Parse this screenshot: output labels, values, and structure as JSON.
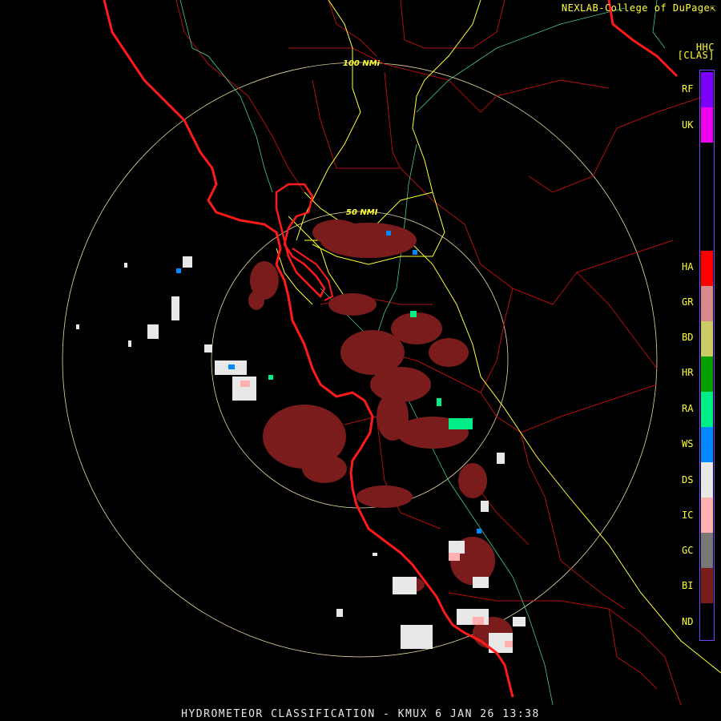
{
  "header": {
    "credit": "NEXLAB-College of DuPage",
    "credit_icon": "external-link-icon",
    "product_code": "HHC",
    "product_mode": "[CLAS]"
  },
  "rings": [
    {
      "label": "50 NMI"
    },
    {
      "label": "100 NMI"
    }
  ],
  "legend": [
    {
      "code": "RF",
      "color": "#7b00ff"
    },
    {
      "code": "UK",
      "color": "#ee00ee"
    },
    {
      "code": "HA",
      "color": "#ff0000"
    },
    {
      "code": "GR",
      "color": "#d88a8a"
    },
    {
      "code": "BD",
      "color": "#cccc66"
    },
    {
      "code": "HR",
      "color": "#00a000"
    },
    {
      "code": "RA",
      "color": "#00ee88"
    },
    {
      "code": "WS",
      "color": "#0088ff"
    },
    {
      "code": "DS",
      "color": "#e8e8e8"
    },
    {
      "code": "IC",
      "color": "#ffb0b0"
    },
    {
      "code": "GC",
      "color": "#777777"
    },
    {
      "code": "BI",
      "color": "#7a1c1c"
    },
    {
      "code": "ND",
      "color": "#000000"
    }
  ],
  "footer": {
    "title": "HYDROMETEOR CLASSIFICATION - KMUX 6 JAN 26 13:38"
  },
  "colors": {
    "coastline": "#ff1a1a",
    "county_lines": "#b01010",
    "highways": "#ffff33",
    "rivers": "#44cc88",
    "range_rings": "#e8d8a0"
  }
}
